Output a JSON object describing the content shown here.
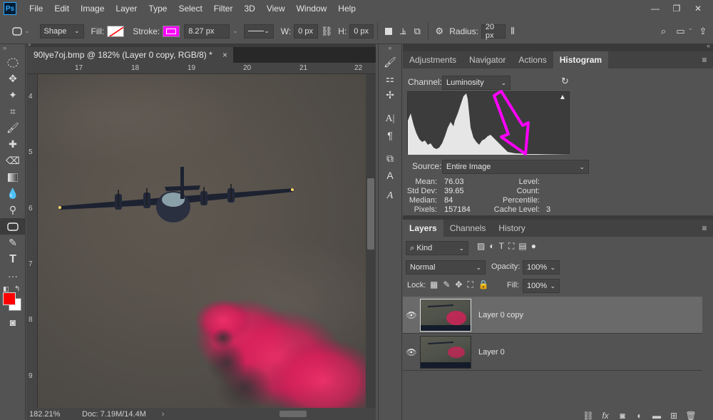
{
  "menubar": {
    "logo": "Ps",
    "items": [
      "File",
      "Edit",
      "Image",
      "Layer",
      "Type",
      "Select",
      "Filter",
      "3D",
      "View",
      "Window",
      "Help"
    ]
  },
  "options": {
    "shape_mode": "Shape",
    "fill_label": "Fill:",
    "stroke_label": "Stroke:",
    "stroke_width": "8.27 px",
    "w_label": "W:",
    "w_value": "0 px",
    "h_label": "H:",
    "h_value": "0 px",
    "radius_label": "Radius:",
    "radius_value": "20 px",
    "stroke_color": "#ff00ff"
  },
  "document": {
    "tab_title": "90lye7oj.bmp @ 182% (Layer 0 copy, RGB/8) *",
    "close_glyph": "×",
    "ruler_top": [
      "17",
      "18",
      "19",
      "20",
      "21",
      "22"
    ],
    "ruler_left": [
      "4",
      "5",
      "6",
      "7",
      "8",
      "9"
    ],
    "zoom": "182.21%",
    "doc_size": "Doc: 7.19M/14.4M"
  },
  "colors": {
    "foreground": "#ff0000",
    "background": "#ffffff",
    "accent_arrow": "#ff00ff",
    "smoke_pink": "#e0205e"
  },
  "histogram_panel": {
    "tabs": [
      "Adjustments",
      "Navigator",
      "Actions",
      "Histogram"
    ],
    "active_tab": "Histogram",
    "channel_label": "Channel:",
    "channel_value": "Luminosity",
    "source_label": "Source:",
    "source_value": "Entire Image",
    "warning_glyph": "▲",
    "stats": {
      "mean_label": "Mean:",
      "mean": "76.03",
      "stddev_label": "Std Dev:",
      "stddev": "39.65",
      "median_label": "Median:",
      "median": "84",
      "pixels_label": "Pixels:",
      "pixels": "157184",
      "level_label": "Level:",
      "level": "",
      "count_label": "Count:",
      "count": "",
      "percentile_label": "Percentile:",
      "percentile": "",
      "cache_label": "Cache Level:",
      "cache": "3"
    }
  },
  "layers_panel": {
    "tabs": [
      "Layers",
      "Channels",
      "History"
    ],
    "active_tab": "Layers",
    "filter_kind": "Kind",
    "blend_mode": "Normal",
    "opacity_label": "Opacity:",
    "opacity_value": "100%",
    "lock_label": "Lock:",
    "fill_label": "Fill:",
    "fill_value": "100%",
    "layers": [
      {
        "name": "Layer 0 copy",
        "selected": true
      },
      {
        "name": "Layer 0",
        "selected": false
      }
    ]
  }
}
